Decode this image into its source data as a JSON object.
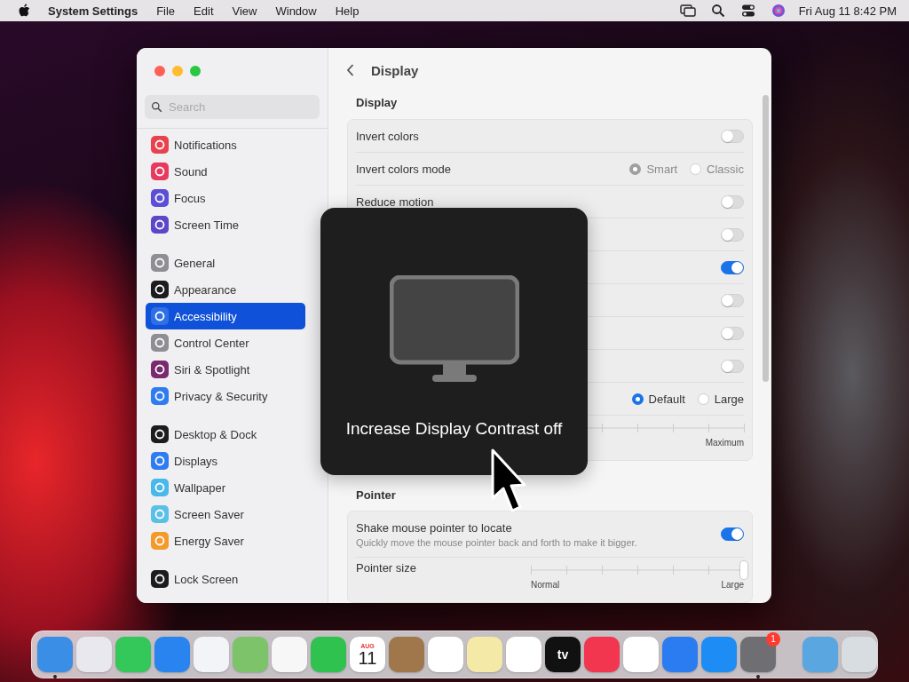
{
  "menu_bar": {
    "app_name": "System Settings",
    "menus": [
      "File",
      "Edit",
      "View",
      "Window",
      "Help"
    ],
    "clock": "Fri Aug 11  8:42 PM"
  },
  "window": {
    "search": {
      "placeholder": "Search"
    },
    "sidebar": {
      "groups": [
        {
          "items": [
            {
              "label": "Notifications",
              "color": "#e8424f",
              "selected": false
            },
            {
              "label": "Sound",
              "color": "#e83a5e",
              "selected": false
            },
            {
              "label": "Focus",
              "color": "#5b4fd6",
              "selected": false
            },
            {
              "label": "Screen Time",
              "color": "#5e46c8",
              "selected": false
            }
          ]
        },
        {
          "items": [
            {
              "label": "General",
              "color": "#8e8e93",
              "selected": false
            },
            {
              "label": "Appearance",
              "color": "#1c1c1e",
              "selected": false
            },
            {
              "label": "Accessibility",
              "color": "#2f6fe6",
              "selected": true
            },
            {
              "label": "Control Center",
              "color": "#8e8e93",
              "selected": false
            },
            {
              "label": "Siri & Spotlight",
              "color": "#7a2a6e",
              "selected": false
            },
            {
              "label": "Privacy & Security",
              "color": "#2f7cf0",
              "selected": false
            }
          ]
        },
        {
          "items": [
            {
              "label": "Desktop & Dock",
              "color": "#1c1c1e",
              "selected": false
            },
            {
              "label": "Displays",
              "color": "#2f7cf0",
              "selected": false
            },
            {
              "label": "Wallpaper",
              "color": "#4ab8ea",
              "selected": false
            },
            {
              "label": "Screen Saver",
              "color": "#5ac0e6",
              "selected": false
            },
            {
              "label": "Energy Saver",
              "color": "#f39a2a",
              "selected": false
            }
          ]
        },
        {
          "items": [
            {
              "label": "Lock Screen",
              "color": "#1c1c1e",
              "selected": false
            }
          ]
        }
      ]
    },
    "title": "Display",
    "sections": [
      {
        "heading": "Display",
        "rows": [
          {
            "kind": "toggle",
            "label": "Invert colors",
            "on": false
          },
          {
            "kind": "radio",
            "label": "Invert colors mode",
            "disabled": true,
            "options": [
              {
                "label": "Smart",
                "selected": true
              },
              {
                "label": "Classic",
                "selected": false
              }
            ]
          },
          {
            "kind": "toggle",
            "label": "Reduce motion",
            "on": false
          },
          {
            "kind": "toggle",
            "on": false
          },
          {
            "kind": "toggle",
            "on": true
          },
          {
            "kind": "toggle",
            "on": false
          },
          {
            "kind": "toggle",
            "on": false
          },
          {
            "kind": "toggle",
            "on": false
          },
          {
            "kind": "radio",
            "disabled": false,
            "options": [
              {
                "label": "Default",
                "selected": true
              },
              {
                "label": "Large",
                "selected": false
              }
            ]
          },
          {
            "kind": "slider",
            "max_label": "Maximum"
          }
        ]
      },
      {
        "heading": "Pointer",
        "rows": [
          {
            "kind": "toggle",
            "label": "Shake mouse pointer to locate",
            "description": "Quickly move the mouse pointer back and forth to make it bigger.",
            "on": true
          },
          {
            "kind": "slider",
            "label": "Pointer size",
            "min_label": "Normal",
            "max_label": "Large",
            "level": 1
          }
        ]
      }
    ]
  },
  "hud": {
    "message": "Increase Display Contrast off"
  },
  "dock": {
    "apps": [
      {
        "color": "#3a8ee6",
        "running": true
      },
      {
        "color": "#e8e8ee",
        "running": false
      },
      {
        "color": "#34c759",
        "running": false
      },
      {
        "color": "#2a84f0",
        "running": false
      },
      {
        "color": "#f2f4f8",
        "running": false
      },
      {
        "color": "#7cc36a",
        "running": false
      },
      {
        "color": "#f7f7f7",
        "running": false
      },
      {
        "color": "#2fc24f",
        "running": false
      },
      {
        "color": "#ffffff",
        "running": false,
        "month": "AUG",
        "day": "11"
      },
      {
        "color": "#a0774a",
        "running": false
      },
      {
        "color": "#ffffff",
        "running": false
      },
      {
        "color": "#f5e9a8",
        "running": false
      },
      {
        "color": "#ffffff",
        "running": false
      },
      {
        "color": "#111111",
        "running": false,
        "text": "tv"
      },
      {
        "color": "#f2364f",
        "running": false
      },
      {
        "color": "#ffffff",
        "running": false
      },
      {
        "color": "#2a7cf0",
        "running": false
      },
      {
        "color": "#1e8cf5",
        "running": false
      },
      {
        "color": "#6e6e73",
        "running": true,
        "badge": "1"
      }
    ],
    "stacks": [
      {
        "color": "#5aa6e0"
      },
      {
        "color": "#d8dde2"
      }
    ]
  }
}
